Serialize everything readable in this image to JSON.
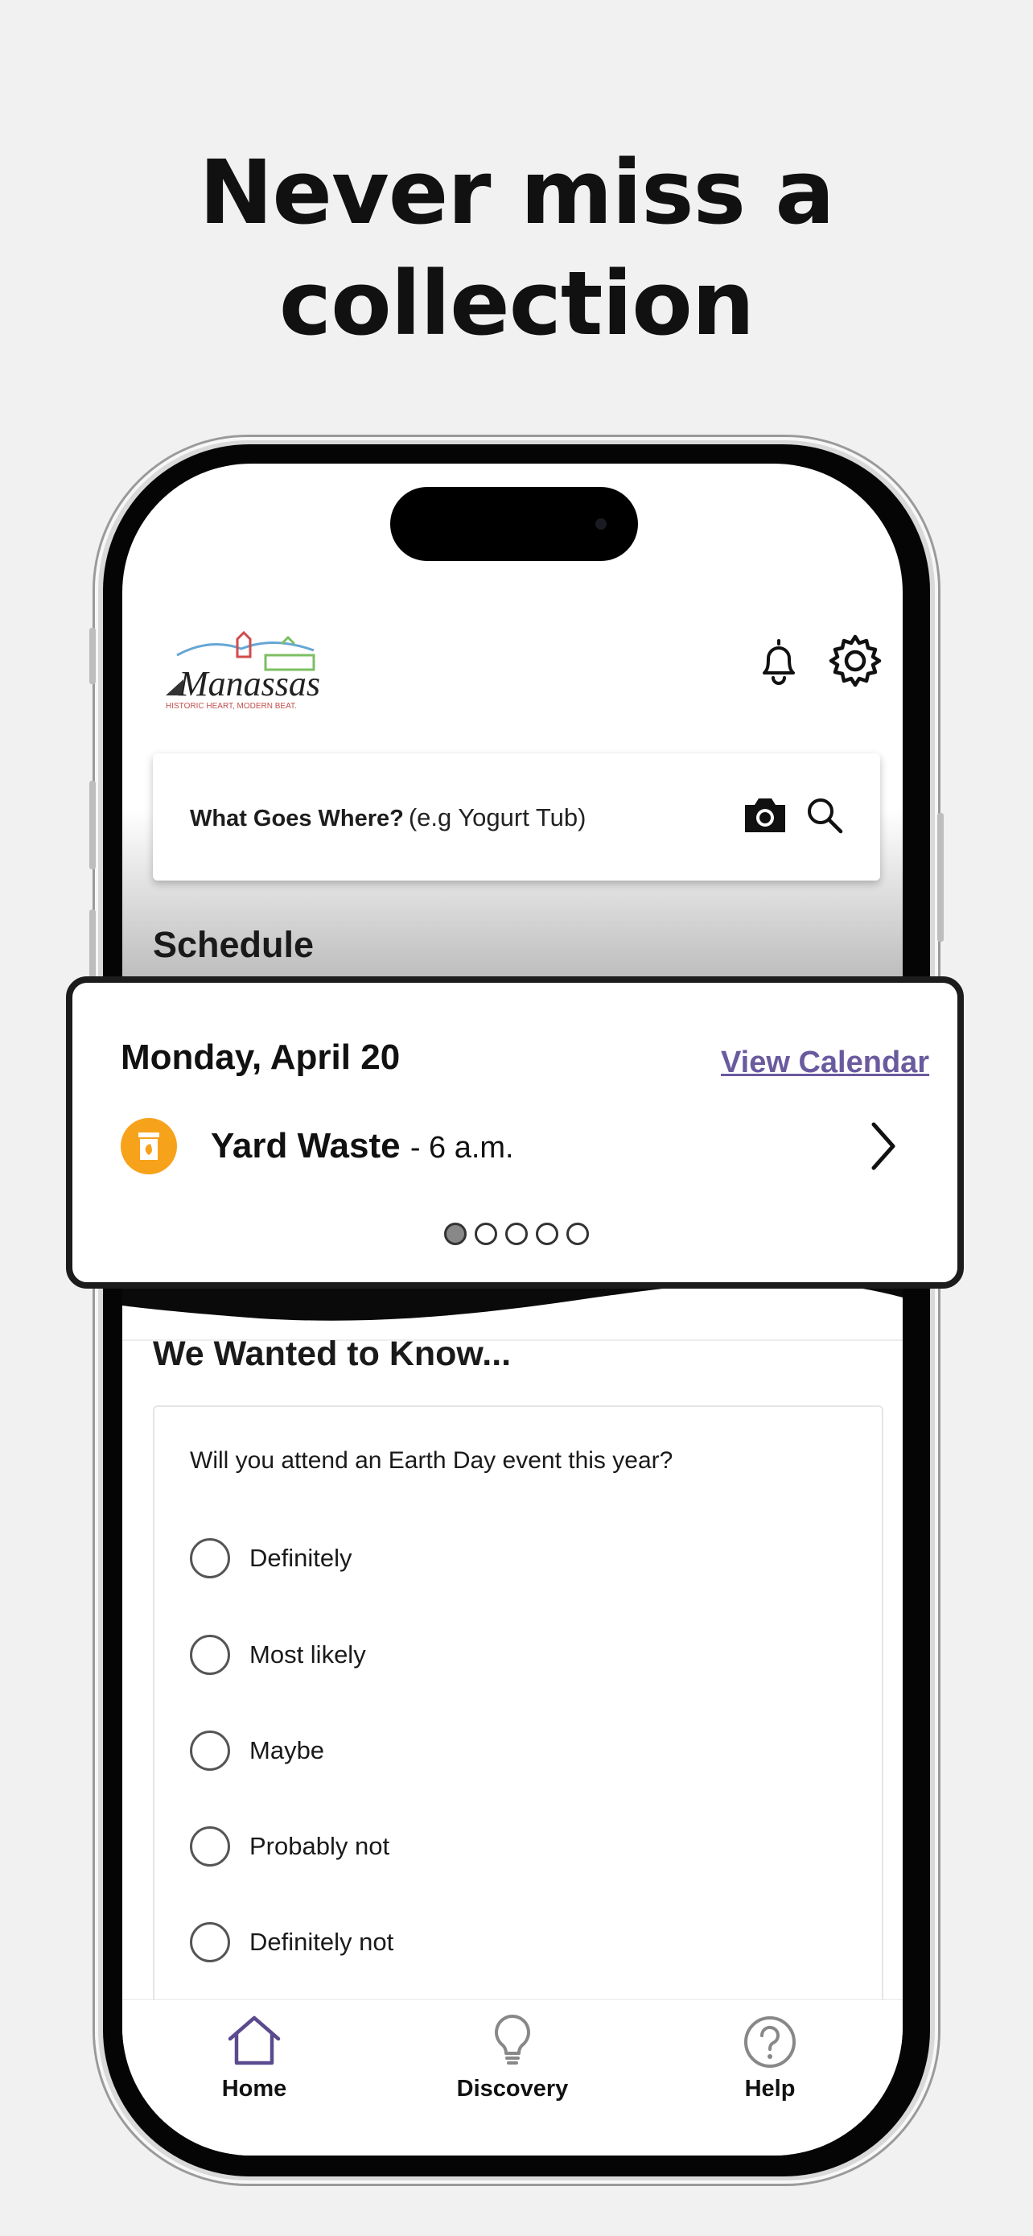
{
  "headline": {
    "line1": "Never miss a",
    "line2": "collection"
  },
  "header": {
    "logo_name": "Manassas",
    "logo_tagline": "HISTORIC HEART, MODERN BEAT.",
    "bell_icon": "bell-icon",
    "settings_icon": "gear-icon"
  },
  "search": {
    "label": "What Goes Where?",
    "placeholder": "(e.g Yogurt Tub)",
    "camera_icon": "camera-icon",
    "search_icon": "search-icon"
  },
  "schedule": {
    "title": "Schedule",
    "date": "Monday, April 20",
    "view_calendar": "View Calendar",
    "item_name": "Yard Waste",
    "item_time": "- 6 a.m.",
    "item_icon": "yard-waste-icon",
    "accent": "#f7a21b",
    "pager_total": 5,
    "pager_active": 1
  },
  "poll": {
    "title": "We Wanted to Know...",
    "question": "Will you attend an Earth Day event this year?",
    "options": [
      "Definitely",
      "Most likely",
      "Maybe",
      "Probably not",
      "Definitely not"
    ]
  },
  "tabs": [
    {
      "label": "Home",
      "icon": "home-icon"
    },
    {
      "label": "Discovery",
      "icon": "lightbulb-icon"
    },
    {
      "label": "Help",
      "icon": "help-icon"
    }
  ],
  "colors": {
    "link": "#6a5a9e",
    "home_active": "#5b4a8e"
  }
}
